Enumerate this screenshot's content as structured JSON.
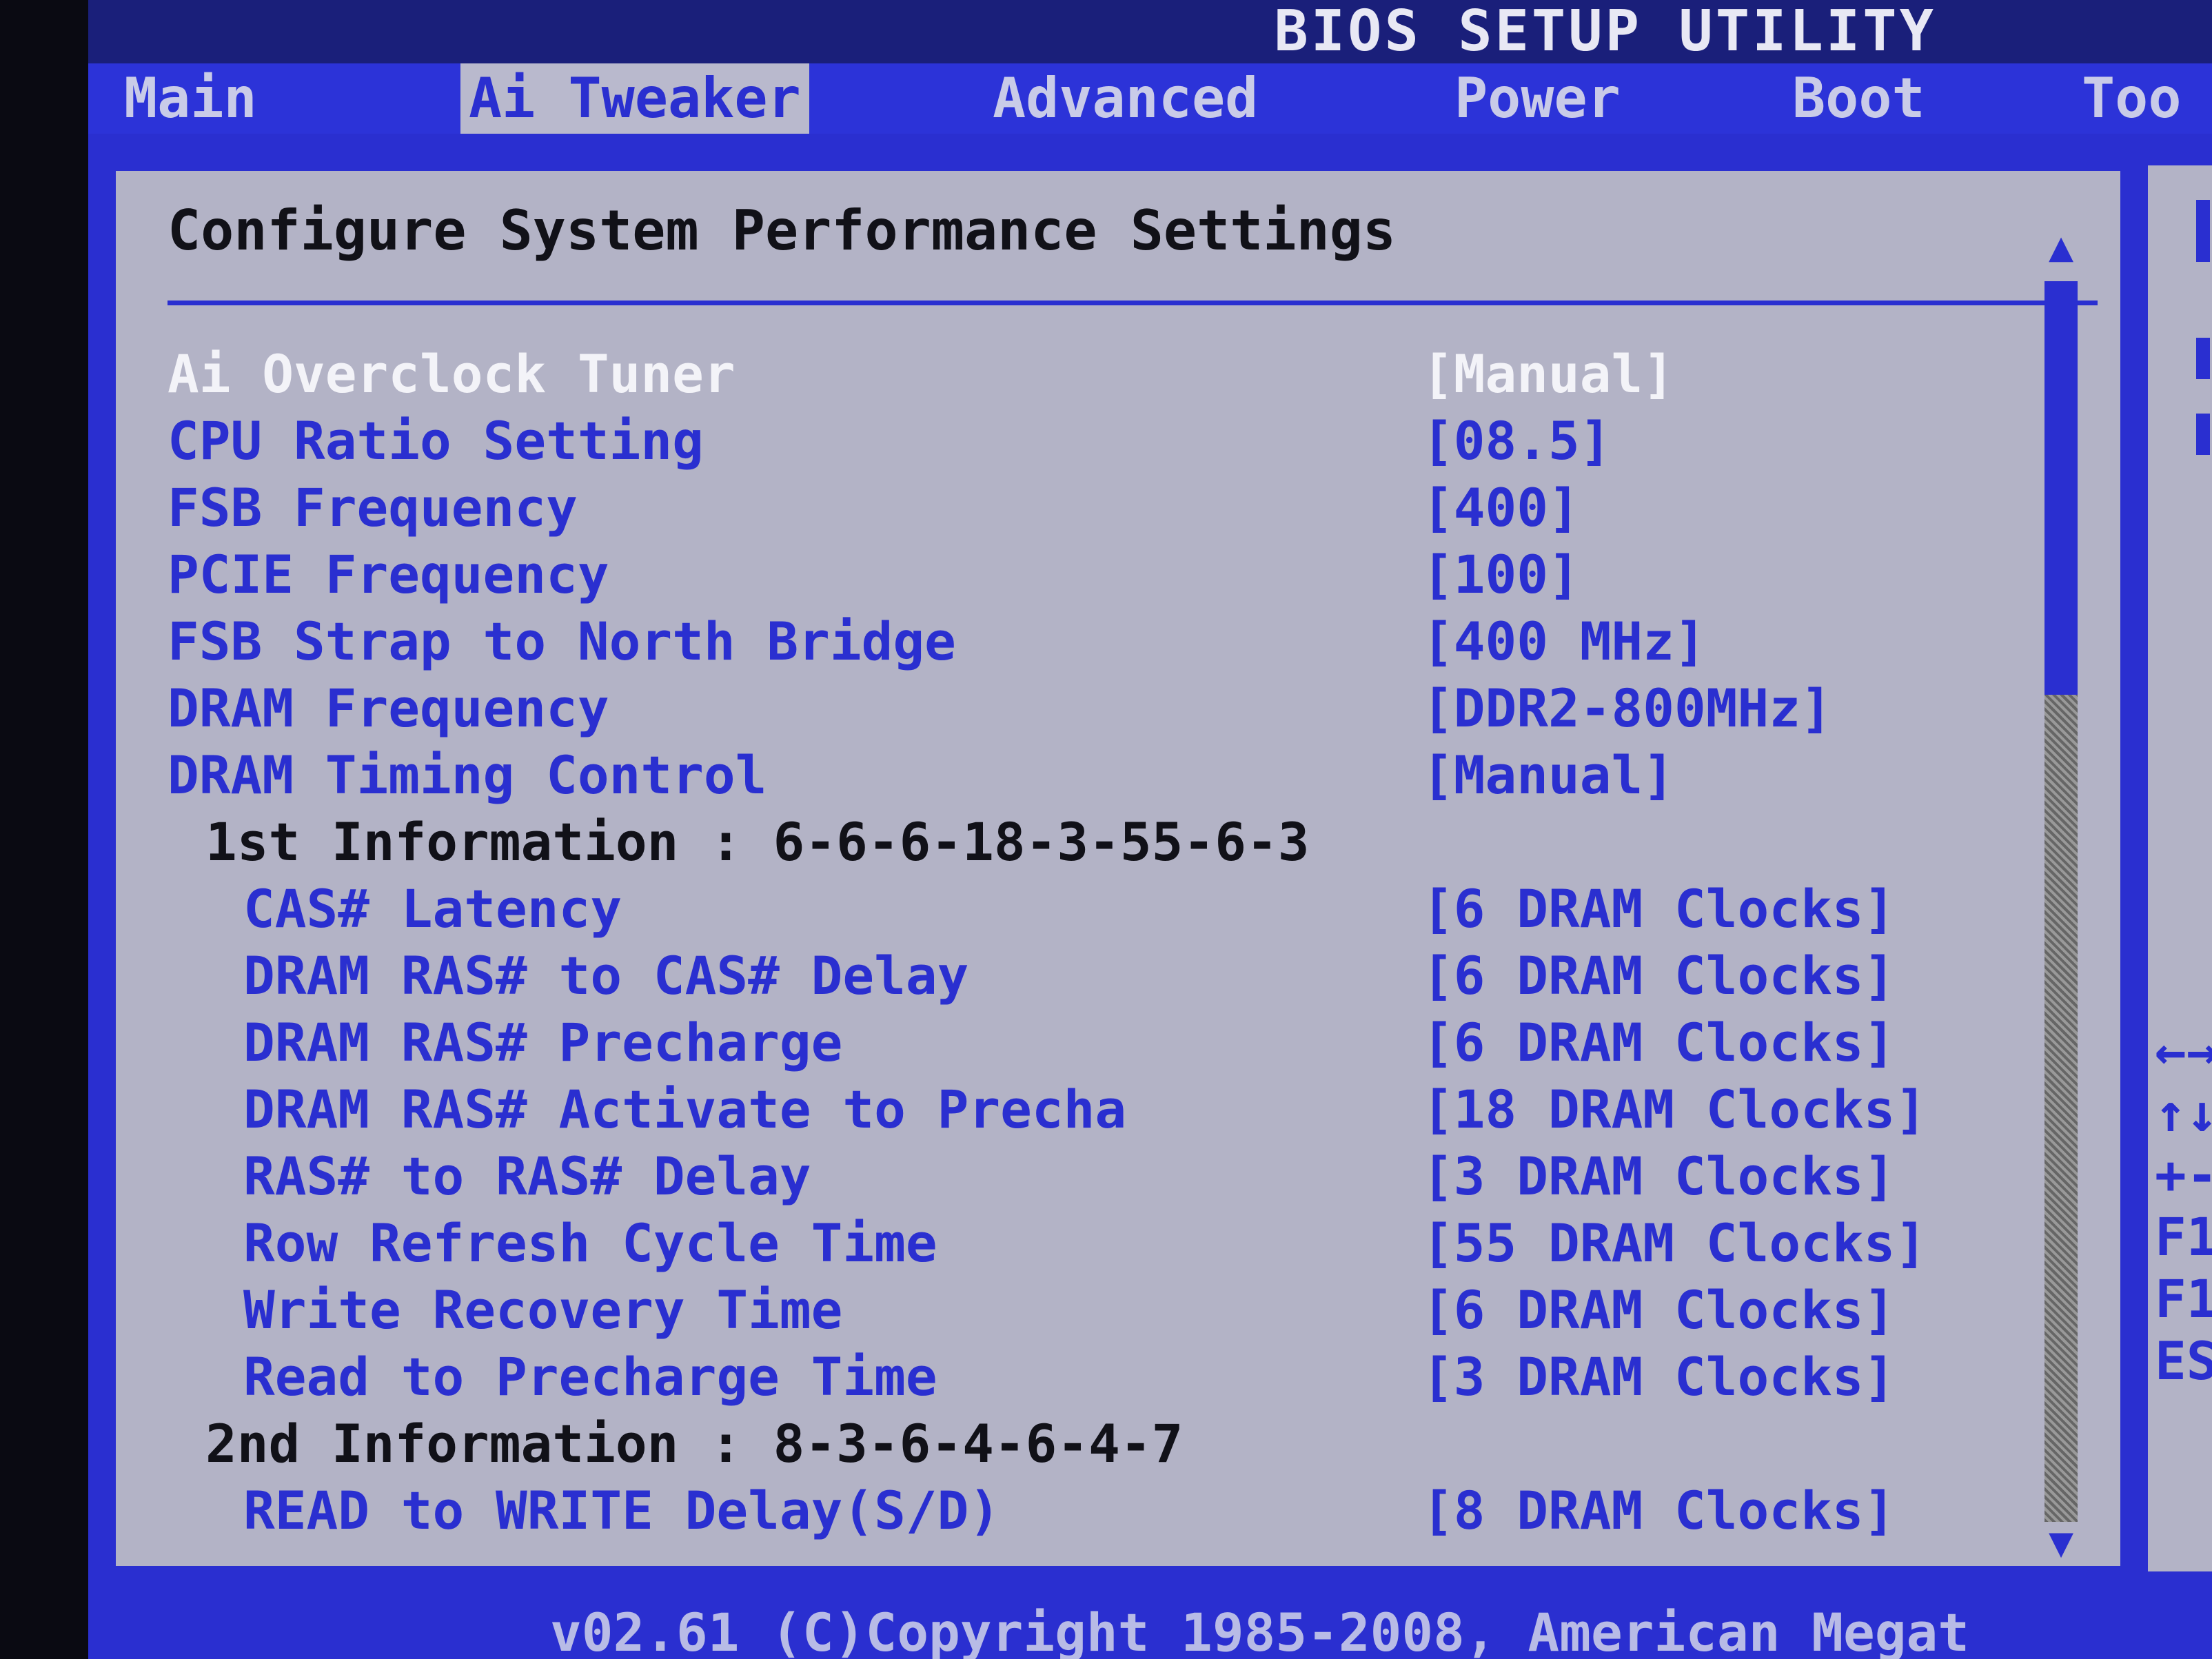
{
  "title": "BIOS SETUP UTILITY",
  "tabs": [
    {
      "label": "Main"
    },
    {
      "label": "Ai Tweaker"
    },
    {
      "label": "Advanced"
    },
    {
      "label": "Power"
    },
    {
      "label": "Boot"
    },
    {
      "label": "Too"
    }
  ],
  "heading": "Configure System Performance Settings",
  "settings": [
    {
      "label": "Ai Overclock Tuner",
      "value": "[Manual]"
    },
    {
      "label": "CPU Ratio Setting",
      "value": "[08.5]"
    },
    {
      "label": "FSB Frequency",
      "value": "[400]"
    },
    {
      "label": "PCIE Frequency",
      "value": "[100]"
    },
    {
      "label": "FSB Strap to North Bridge",
      "value": "[400 MHz]"
    },
    {
      "label": "DRAM Frequency",
      "value": "[DDR2-800MHz]"
    },
    {
      "label": "DRAM Timing Control",
      "value": "[Manual]"
    },
    {
      "label": "1st Information : 6-6-6-18-3-55-6-3"
    },
    {
      "label": "CAS# Latency",
      "value": "[6 DRAM Clocks]"
    },
    {
      "label": "DRAM RAS# to CAS# Delay",
      "value": "[6 DRAM Clocks]"
    },
    {
      "label": "DRAM RAS# Precharge",
      "value": "[6 DRAM Clocks]"
    },
    {
      "label": "DRAM RAS# Activate to Precha",
      "value": "[18 DRAM Clocks]"
    },
    {
      "label": "RAS# to RAS# Delay",
      "value": "[3 DRAM Clocks]"
    },
    {
      "label": "Row Refresh Cycle Time",
      "value": "[55 DRAM Clocks]"
    },
    {
      "label": "Write Recovery Time",
      "value": "[6 DRAM Clocks]"
    },
    {
      "label": "Read to Precharge Time",
      "value": "[3 DRAM Clocks]"
    },
    {
      "label": "2nd Information : 8-3-6-4-6-4-7"
    },
    {
      "label": "READ to WRITE Delay(S/D)",
      "value": "[8 DRAM Clocks]"
    }
  ],
  "help_keys": [
    "←→",
    "↑↓",
    "+-",
    "F1",
    "F1",
    "ES"
  ],
  "scroll_up": "▲",
  "scroll_down": "▼",
  "footer": "v02.61 (C)Copyright 1985-2008, American Megat",
  "colors": {
    "background": "#2a2fd0",
    "panel": "#b3b3c6",
    "highlight": "#f3f3f8",
    "text": "#111118"
  }
}
